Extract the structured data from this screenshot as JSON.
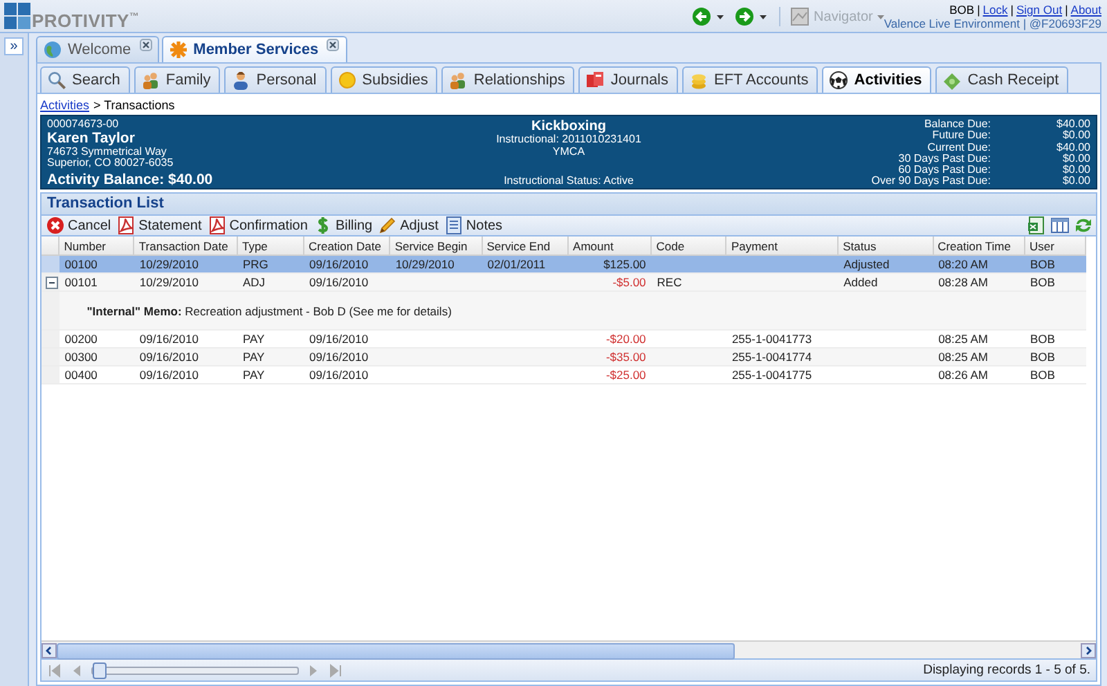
{
  "header": {
    "logo": "PROTIVITY$^{™}$",
    "navigator": {
      "label": "Navigator",
      "disabled": true
    },
    "user": "BOB",
    "separator": "|",
    "links": [
      "Lock",
      "Sign Out",
      "About"
    ],
    "environment": "Valence Live Environment | @F20693F29"
  },
  "sidebar_toggle": "»",
  "main_tabs": [
    {
      "label": "Welcome",
      "selected": false
    },
    {
      "label": "Member Services",
      "selected": true
    }
  ],
  "sub_tabs": [
    {
      "label": "Search",
      "selected": false
    },
    {
      "label": "Family",
      "selected": false
    },
    {
      "label": "Personal",
      "selected": false
    },
    {
      "label": "Subsidies",
      "selected": false
    },
    {
      "label": "Relationships",
      "selected": false
    },
    {
      "label": "Journals",
      "selected": false
    },
    {
      "label": "EFT Accounts",
      "selected": false
    },
    {
      "label": "Activities",
      "selected": true
    },
    {
      "label": "Cash Receipt",
      "selected": false
    }
  ],
  "breadcrumb": {
    "link": "Activities",
    "current": "> Transactions"
  },
  "account": {
    "number": "000074673-00",
    "name": "Karen Taylor",
    "address": [
      "74673 Symmetrical Way",
      "Superior, CO 80027-6035"
    ],
    "balance": "Activity Balance: $40.00",
    "activity": "Kickboxing",
    "instructional": "Instructional: 2011010231401",
    "organization": "YMCA",
    "status": "Instructional Status: Active",
    "dues": [
      {
        "label": "Balance Due:",
        "value": "$40.00"
      },
      {
        "label": "Future Due:",
        "value": "$0.00"
      },
      {
        "label": "Current Due:",
        "value": "$40.00"
      },
      {
        "label": "30 Days Past Due:",
        "value": "$0.00"
      },
      {
        "label": "60 Days Past Due:",
        "value": "$0.00"
      },
      {
        "label": "Over 90 Days Past Due:",
        "value": "$0.00"
      }
    ]
  },
  "grid": {
    "title": "Transaction List",
    "toolbar": [
      "Cancel",
      "Statement",
      "Confirmation",
      "Billing",
      "Adjust",
      "Notes"
    ],
    "columns": [
      "Number",
      "Transaction Date",
      "Type",
      "Creation Date",
      "Service Begin",
      "Service End",
      "Amount",
      "Code",
      "Payment",
      "Status",
      "Creation Time",
      "User"
    ],
    "rows": [
      {
        "selected": true,
        "expanded": false,
        "credit": false,
        "cells": [
          "00100",
          "10/29/2010",
          "PRG",
          "09/16/2010",
          "10/29/2010",
          "02/01/2011",
          "$125.00",
          "",
          "",
          "Adjusted",
          "08:20 AM",
          "BOB"
        ]
      },
      {
        "selected": false,
        "expanded": true,
        "credit": true,
        "cells": [
          "00101",
          "10/29/2010",
          "ADJ",
          "09/16/2010",
          "",
          "",
          "-$5.00",
          "REC",
          "",
          "Added",
          "08:28 AM",
          "BOB"
        ],
        "memo": "**\"Internal\" Memo:**  Recreation adjustment - Bob D (See me for details)"
      },
      {
        "selected": false,
        "expanded": false,
        "credit": true,
        "cells": [
          "00200",
          "09/16/2010",
          "PAY",
          "09/16/2010",
          "",
          "",
          "-$20.00",
          "",
          "255-1-0041773",
          "",
          "08:25 AM",
          "BOB"
        ]
      },
      {
        "selected": false,
        "expanded": false,
        "credit": true,
        "cells": [
          "00300",
          "09/16/2010",
          "PAY",
          "09/16/2010",
          "",
          "",
          "-$35.00",
          "",
          "255-1-0041774",
          "",
          "08:25 AM",
          "BOB"
        ]
      },
      {
        "selected": false,
        "expanded": false,
        "credit": true,
        "cells": [
          "00400",
          "09/16/2010",
          "PAY",
          "09/16/2010",
          "",
          "",
          "-$25.00",
          "",
          "255-1-0041775",
          "",
          "08:26 AM",
          "BOB"
        ]
      }
    ],
    "pager": {
      "level": 0,
      "summary": "Displaying records 1 - 5 of 5."
    }
  }
}
